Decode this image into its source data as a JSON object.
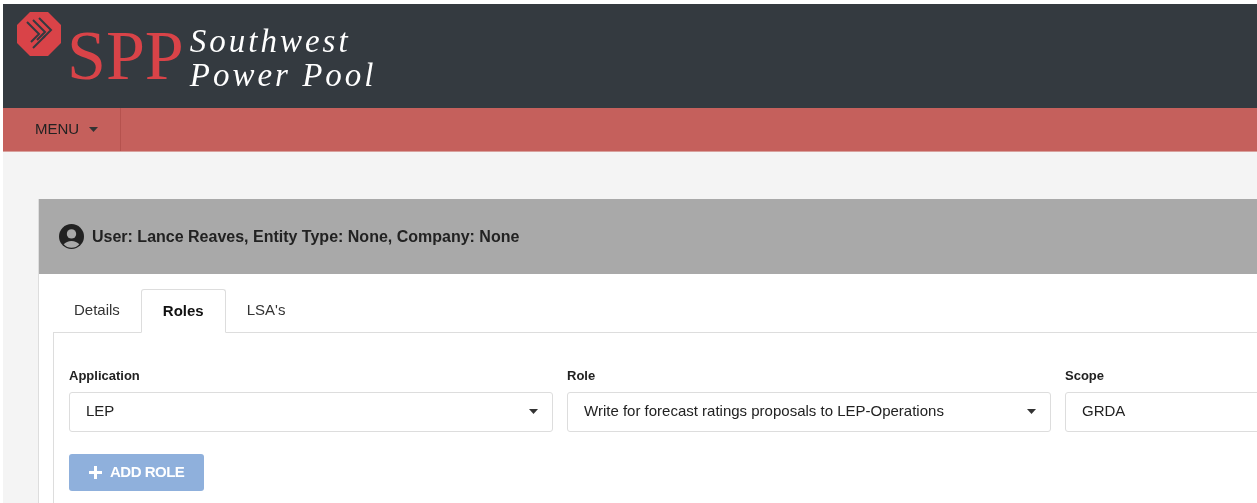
{
  "header": {
    "logo_mark": "SPP",
    "logo_line_1": "Southwest",
    "logo_line_2": "Power Pool"
  },
  "nav": {
    "menu_label": "MENU"
  },
  "user_panel": {
    "title": "User: Lance Reaves, Entity Type: None, Company: None"
  },
  "tabs": [
    {
      "label": "Details",
      "selected": false
    },
    {
      "label": "Roles",
      "selected": true
    },
    {
      "label": "LSA's",
      "selected": false
    }
  ],
  "fields": [
    {
      "label": "Application",
      "value": "LEP"
    },
    {
      "label": "Role",
      "value": "Write for forecast ratings proposals to LEP-Operations"
    },
    {
      "label": "Scope",
      "value": "GRDA"
    }
  ],
  "add_button": {
    "label": "ADD ROLE",
    "disabled": true
  }
}
